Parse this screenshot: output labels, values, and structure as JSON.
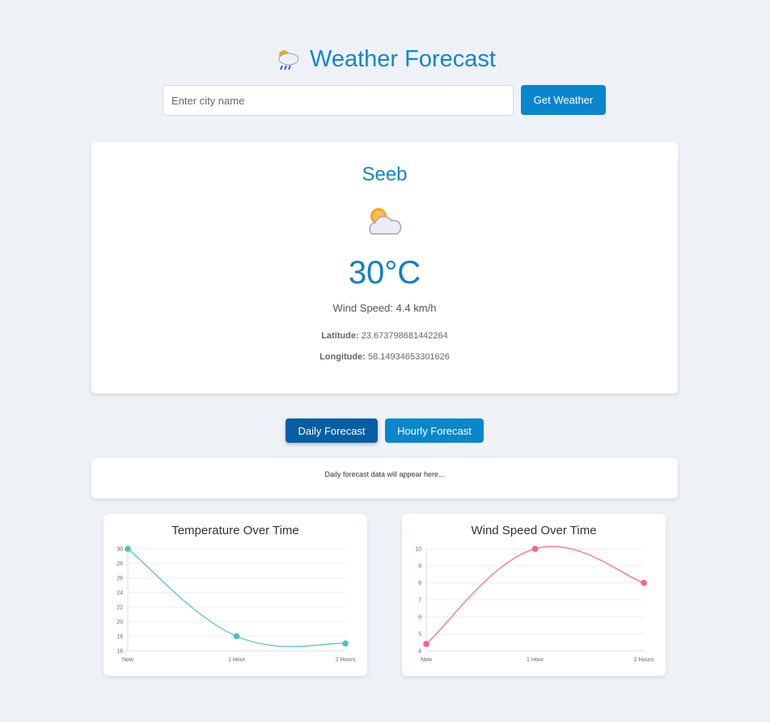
{
  "header": {
    "title": "Weather Forecast",
    "icon": "rain-cloud-icon"
  },
  "search": {
    "placeholder": "Enter city name",
    "value": "",
    "button_label": "Get Weather"
  },
  "current": {
    "city": "Seeb",
    "icon": "partly-cloudy-icon",
    "temperature": "30°C",
    "wind_speed": "Wind Speed: 4.4 km/h",
    "latitude_label": "Latitude:",
    "latitude_value": "23.673798681442264",
    "longitude_label": "Longitude:",
    "longitude_value": "58.14934653301626"
  },
  "tabs": {
    "daily": "Daily Forecast",
    "hourly": "Hourly Forecast",
    "active": "daily"
  },
  "forecast": {
    "placeholder_text": "Daily forecast data will appear here..."
  },
  "colors": {
    "accent": "#0a86cd",
    "active_tab": "#055ea3",
    "temp_line": "#4bc0c0",
    "wind_line": "#ff6384"
  },
  "chart_data": [
    {
      "type": "line",
      "title": "Temperature Over Time",
      "x": [
        "Now",
        "1 Hour",
        "2 Hours"
      ],
      "series": [
        {
          "values": [
            30,
            18,
            17
          ]
        }
      ],
      "ylim": [
        16,
        30
      ],
      "yticks": [
        "30",
        "28",
        "26",
        "24",
        "22",
        "20",
        "18",
        "16"
      ],
      "grid": true
    },
    {
      "type": "line",
      "title": "Wind Speed Over Time",
      "x": [
        "Now",
        "1 Hour",
        "2 Hours"
      ],
      "series": [
        {
          "values": [
            4.4,
            10,
            8
          ]
        }
      ],
      "ylim": [
        4,
        10
      ],
      "yticks": [
        "10",
        "9",
        "8",
        "7",
        "6",
        "5",
        "4"
      ],
      "grid": true
    }
  ]
}
